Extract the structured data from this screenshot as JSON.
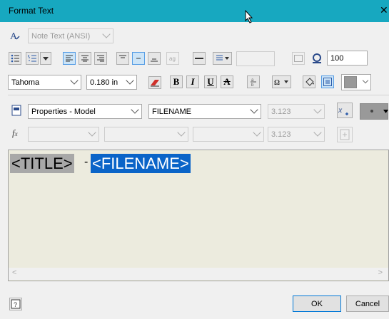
{
  "dialog": {
    "title": "Format Text"
  },
  "style_row": {
    "text_style": "Note Text (ANSI)"
  },
  "para_row": {
    "width_scale": "100"
  },
  "font_row": {
    "font": "Tahoma",
    "size": "0.180 in"
  },
  "props_row": {
    "type": "Properties - Model",
    "property": "FILENAME",
    "precision": "3.123"
  },
  "params_row": {
    "precision": "3.123"
  },
  "editor": {
    "token_title": "<TITLE>",
    "separator": "-",
    "token_filename": "<FILENAME>"
  },
  "footer": {
    "ok_label": "OK",
    "cancel_label": "Cancel"
  },
  "colors": {
    "titlebar": "#17a8c0",
    "selection": "#0a64c8",
    "editor_bg": "#ecebde"
  }
}
